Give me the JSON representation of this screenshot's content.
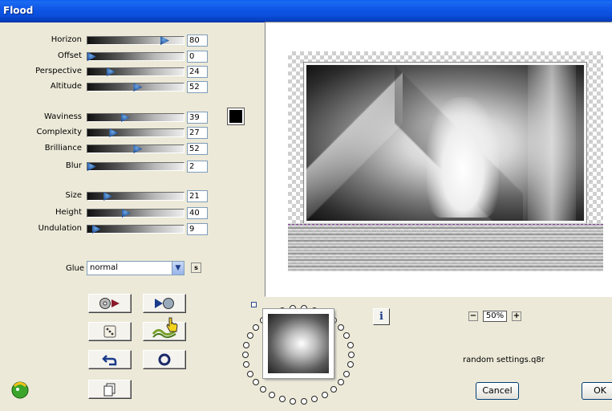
{
  "window": {
    "title": "Flood"
  },
  "sliders": [
    {
      "label": "Horizon",
      "value": "80",
      "level": 0.8
    },
    {
      "label": "Offset",
      "value": "0",
      "level": 0.0
    },
    {
      "label": "Perspective",
      "value": "24",
      "level": 0.24
    },
    {
      "label": "Altitude",
      "value": "52",
      "level": 0.52
    },
    {
      "label": "Waviness",
      "value": "39",
      "level": 0.39
    },
    {
      "label": "Complexity",
      "value": "27",
      "level": 0.27
    },
    {
      "label": "Brilliance",
      "value": "52",
      "level": 0.52
    },
    {
      "label": "Blur",
      "value": "2",
      "level": 0.02
    },
    {
      "label": "Size",
      "value": "21",
      "level": 0.21
    },
    {
      "label": "Height",
      "value": "40",
      "level": 0.4
    },
    {
      "label": "Undulation",
      "value": "9",
      "level": 0.09
    }
  ],
  "color_swatch": "#000000",
  "glue": {
    "label": "Glue",
    "value": "normal",
    "s_label": "s"
  },
  "buttons": {
    "render_icon": "film-reel-play-icon",
    "play_icon": "play-reset-icon",
    "randomize_icon": "dice-icon",
    "wave_icon": "wave-icon",
    "undo_icon": "undo-arrow-icon",
    "circle_icon": "ring-icon",
    "copy_icon": "pages-icon"
  },
  "preview": {
    "info_label": "i"
  },
  "zoom": {
    "value": "50%",
    "minus": "−",
    "plus": "+"
  },
  "settings_file": "random settings.q8r",
  "dialog": {
    "cancel_label": "Cancel",
    "ok_label": "OK"
  }
}
